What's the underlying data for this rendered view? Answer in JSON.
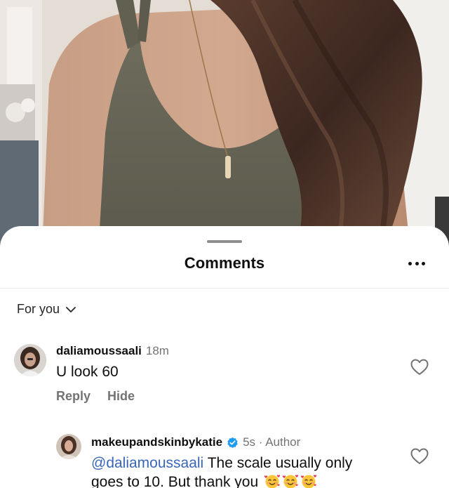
{
  "sheet": {
    "title": "Comments",
    "more_icon": "more-horizontal-icon"
  },
  "filter": {
    "label": "For you",
    "icon": "chevron-down-icon"
  },
  "comments": [
    {
      "username": "daliamoussaali",
      "time": "18m",
      "text": "U look 60",
      "reply_label": "Reply",
      "hide_label": "Hide",
      "like_icon": "heart-outline-icon"
    }
  ],
  "replies": [
    {
      "username": "makeupandskinbykatie",
      "verified": true,
      "time_author": "5s · Author",
      "mention": "@daliamoussaali",
      "text": " The scale usually only goes to 10. But thank you",
      "emoji": "smiling-face-with-hearts-icon",
      "emoji_count": 3,
      "like_icon": "heart-outline-icon"
    }
  ],
  "colors": {
    "mention": "#3b66b8",
    "secondary_text": "#737373",
    "verified_badge": "#1d9bf0",
    "emoji_yellow": "#f9c53a",
    "emoji_heart": "#e8384f"
  }
}
